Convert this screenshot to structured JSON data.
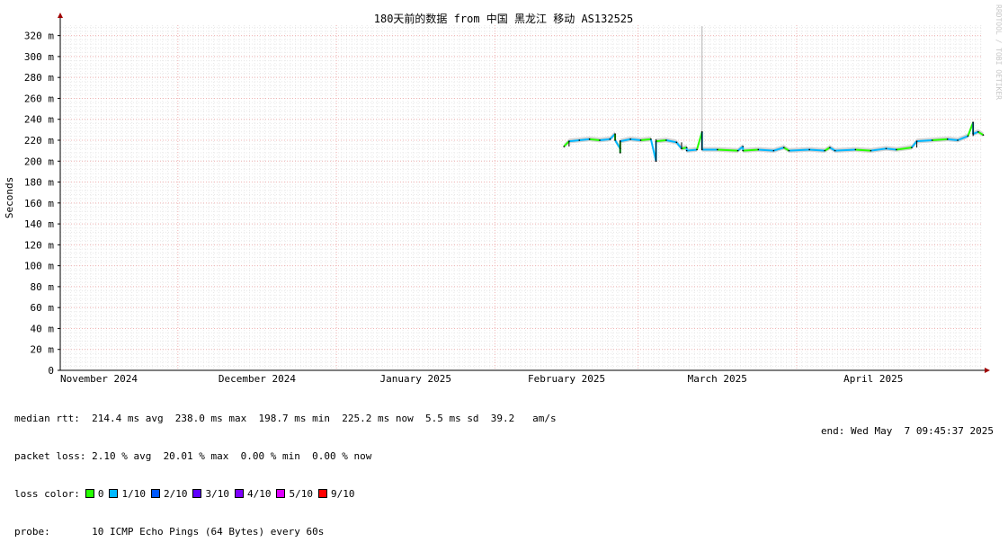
{
  "title": "180天前的数据 from 中国 黑龙江 移动 AS132525",
  "watermark": "RRDTOOL / TOBI OETIKER",
  "chart_data": {
    "type": "line",
    "ylabel": "Seconds",
    "ylim": [
      0,
      330
    ],
    "y_ticks": [
      {
        "value": 0,
        "label": "0"
      },
      {
        "value": 20,
        "label": "20 m"
      },
      {
        "value": 40,
        "label": "40 m"
      },
      {
        "value": 60,
        "label": "60 m"
      },
      {
        "value": 80,
        "label": "80 m"
      },
      {
        "value": 100,
        "label": "100 m"
      },
      {
        "value": 120,
        "label": "120 m"
      },
      {
        "value": 140,
        "label": "140 m"
      },
      {
        "value": 160,
        "label": "160 m"
      },
      {
        "value": 180,
        "label": "180 m"
      },
      {
        "value": 200,
        "label": "200 m"
      },
      {
        "value": 220,
        "label": "220 m"
      },
      {
        "value": 240,
        "label": "240 m"
      },
      {
        "value": 260,
        "label": "260 m"
      },
      {
        "value": 280,
        "label": "280 m"
      },
      {
        "value": 300,
        "label": "300 m"
      },
      {
        "value": 320,
        "label": "320 m"
      }
    ],
    "x_range": [
      "2024-11-08",
      "2025-05-07"
    ],
    "x_ticks": [
      {
        "date": "2024-11-01",
        "label": "November 2024"
      },
      {
        "date": "2024-12-01",
        "label": "December 2024"
      },
      {
        "date": "2025-01-01",
        "label": "January 2025"
      },
      {
        "date": "2025-02-01",
        "label": "February 2025"
      },
      {
        "date": "2025-03-01",
        "label": "March 2025"
      },
      {
        "date": "2025-04-01",
        "label": "April 2025"
      }
    ],
    "grid": true,
    "series": [
      {
        "name": "median rtt",
        "points": [
          [
            "2025-02-14",
            214
          ],
          [
            "2025-02-15",
            219
          ],
          [
            "2025-02-17",
            220
          ],
          [
            "2025-02-19",
            221
          ],
          [
            "2025-02-21",
            220
          ],
          [
            "2025-02-23",
            221
          ],
          [
            "2025-02-24",
            226
          ],
          [
            "2025-02-24",
            220
          ],
          [
            "2025-02-25",
            212
          ],
          [
            "2025-02-25",
            208
          ],
          [
            "2025-02-25",
            219
          ],
          [
            "2025-02-27",
            221
          ],
          [
            "2025-03-01",
            220
          ],
          [
            "2025-03-03",
            221
          ],
          [
            "2025-03-04",
            200
          ],
          [
            "2025-03-04",
            219
          ],
          [
            "2025-03-06",
            220
          ],
          [
            "2025-03-08",
            218
          ],
          [
            "2025-03-09",
            212
          ],
          [
            "2025-03-10",
            213
          ],
          [
            "2025-03-10",
            210
          ],
          [
            "2025-03-12",
            211
          ],
          [
            "2025-03-13",
            228
          ],
          [
            "2025-03-13",
            211
          ],
          [
            "2025-03-16",
            211
          ],
          [
            "2025-03-20",
            210
          ],
          [
            "2025-03-21",
            214
          ],
          [
            "2025-03-21",
            210
          ],
          [
            "2025-03-24",
            211
          ],
          [
            "2025-03-27",
            210
          ],
          [
            "2025-03-29",
            213
          ],
          [
            "2025-03-30",
            210
          ],
          [
            "2025-04-03",
            211
          ],
          [
            "2025-04-06",
            210
          ],
          [
            "2025-04-07",
            213
          ],
          [
            "2025-04-08",
            210
          ],
          [
            "2025-04-12",
            211
          ],
          [
            "2025-04-15",
            210
          ],
          [
            "2025-04-18",
            212
          ],
          [
            "2025-04-20",
            211
          ],
          [
            "2025-04-23",
            213
          ],
          [
            "2025-04-24",
            219
          ],
          [
            "2025-04-27",
            220
          ],
          [
            "2025-04-30",
            221
          ],
          [
            "2025-05-02",
            220
          ],
          [
            "2025-05-04",
            224
          ],
          [
            "2025-05-05",
            237
          ],
          [
            "2025-05-05",
            226
          ],
          [
            "2025-05-06",
            228
          ],
          [
            "2025-05-07",
            225
          ]
        ]
      }
    ],
    "spike": {
      "date": "2025-03-13",
      "value": 329
    },
    "loss_colors": [
      {
        "label": "0",
        "color": "#26ff00"
      },
      {
        "label": "1/10",
        "color": "#00b8ff"
      },
      {
        "label": "2/10",
        "color": "#0059ff"
      },
      {
        "label": "3/10",
        "color": "#5e00ff"
      },
      {
        "label": "4/10",
        "color": "#7e00ff"
      },
      {
        "label": "5/10",
        "color": "#dd00ff"
      },
      {
        "label": "9/10",
        "color": "#ff0000"
      }
    ]
  },
  "stats": {
    "median_rtt_line": "median rtt:  214.4 ms avg  238.0 ms max  198.7 ms min  225.2 ms now  5.5 ms sd  39.2   am/s",
    "packet_loss_line": "packet loss: 2.10 % avg  20.01 % max  0.00 % min  0.00 % now",
    "loss_color_label": "loss color:",
    "probe_line": "probe:       10 ICMP Echo Pings (64 Bytes) every 60s",
    "end_line": "end: Wed May  7 09:45:37 2025"
  }
}
